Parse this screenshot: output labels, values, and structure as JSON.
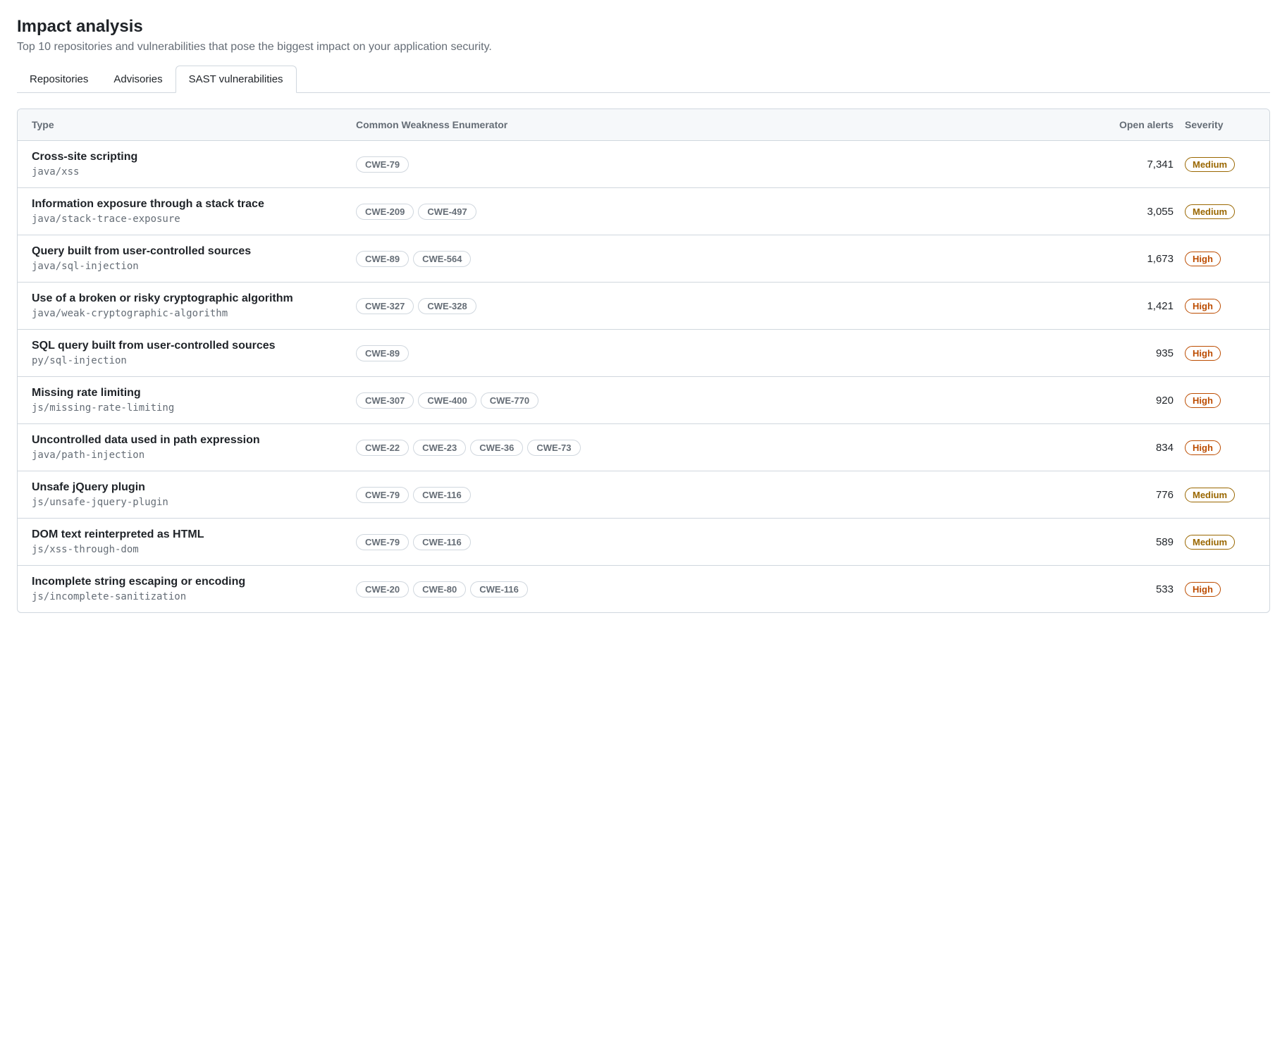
{
  "header": {
    "title": "Impact analysis",
    "subtitle": "Top 10 repositories and vulnerabilities that pose the biggest impact on your application security."
  },
  "tabs": [
    {
      "label": "Repositories",
      "active": false
    },
    {
      "label": "Advisories",
      "active": false
    },
    {
      "label": "SAST vulnerabilities",
      "active": true
    }
  ],
  "columns": {
    "type": "Type",
    "cwe": "Common Weakness Enumerator",
    "alerts": "Open alerts",
    "severity": "Severity"
  },
  "rows": [
    {
      "title": "Cross-site scripting",
      "sub": "java/xss",
      "cwes": [
        "CWE-79"
      ],
      "alerts": "7,341",
      "severity": "Medium"
    },
    {
      "title": "Information exposure through a stack trace",
      "sub": "java/stack-trace-exposure",
      "cwes": [
        "CWE-209",
        "CWE-497"
      ],
      "alerts": "3,055",
      "severity": "Medium"
    },
    {
      "title": "Query built from user-controlled sources",
      "sub": "java/sql-injection",
      "cwes": [
        "CWE-89",
        "CWE-564"
      ],
      "alerts": "1,673",
      "severity": "High"
    },
    {
      "title": "Use of a broken or risky cryptographic algorithm",
      "sub": "java/weak-cryptographic-algorithm",
      "cwes": [
        "CWE-327",
        "CWE-328"
      ],
      "alerts": "1,421",
      "severity": "High"
    },
    {
      "title": "SQL query built from user-controlled sources",
      "sub": "py/sql-injection",
      "cwes": [
        "CWE-89"
      ],
      "alerts": "935",
      "severity": "High"
    },
    {
      "title": "Missing rate limiting",
      "sub": "js/missing-rate-limiting",
      "cwes": [
        "CWE-307",
        "CWE-400",
        "CWE-770"
      ],
      "alerts": "920",
      "severity": "High"
    },
    {
      "title": "Uncontrolled data used in path expression",
      "sub": "java/path-injection",
      "cwes": [
        "CWE-22",
        "CWE-23",
        "CWE-36",
        "CWE-73"
      ],
      "alerts": "834",
      "severity": "High"
    },
    {
      "title": "Unsafe jQuery plugin",
      "sub": "js/unsafe-jquery-plugin",
      "cwes": [
        "CWE-79",
        "CWE-116"
      ],
      "alerts": "776",
      "severity": "Medium"
    },
    {
      "title": "DOM text reinterpreted as HTML",
      "sub": "js/xss-through-dom",
      "cwes": [
        "CWE-79",
        "CWE-116"
      ],
      "alerts": "589",
      "severity": "Medium"
    },
    {
      "title": "Incomplete string escaping or encoding",
      "sub": "js/incomplete-sanitization",
      "cwes": [
        "CWE-20",
        "CWE-80",
        "CWE-116"
      ],
      "alerts": "533",
      "severity": "High"
    }
  ]
}
